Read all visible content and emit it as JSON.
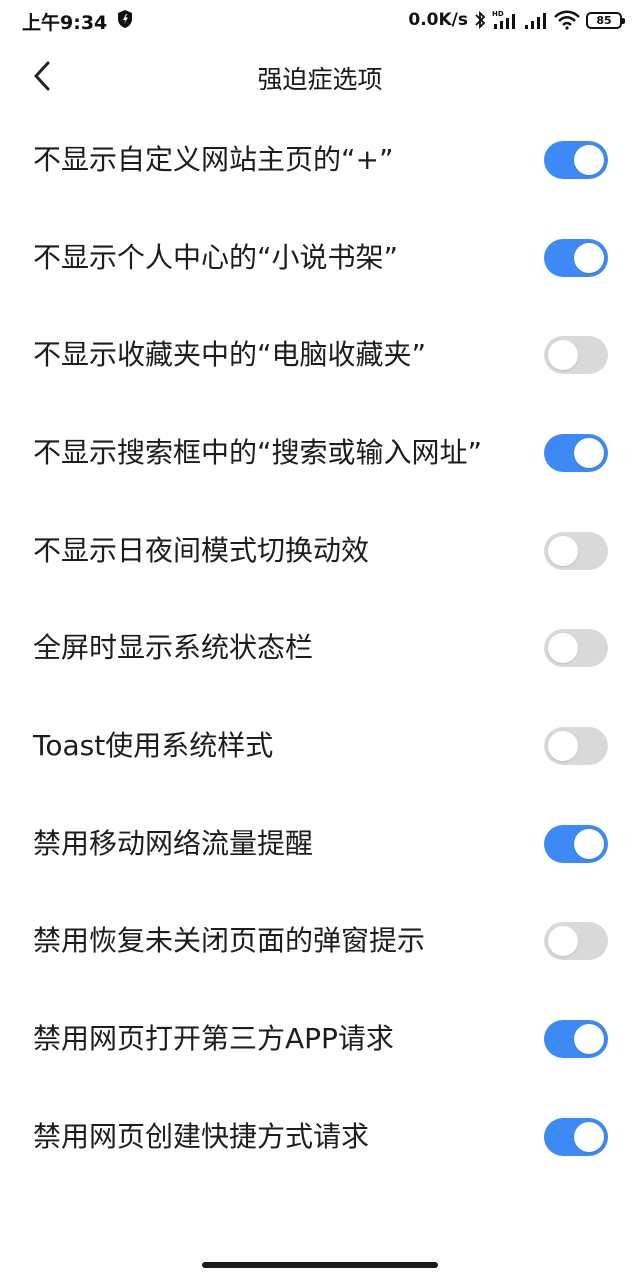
{
  "status_bar": {
    "time": "上午9:34",
    "net_speed": "0.0K/s",
    "battery": "85",
    "icons": [
      "shield-icon",
      "bluetooth-icon",
      "hd-signal-icon",
      "signal-icon",
      "wifi-icon",
      "battery-icon"
    ]
  },
  "header": {
    "title": "强迫症选项",
    "back_icon": "chevron-left-icon"
  },
  "settings": [
    {
      "label": "不显示自定义网站主页的“+”",
      "enabled": true
    },
    {
      "label": "不显示个人中心的“小说书架”",
      "enabled": true
    },
    {
      "label": "不显示收藏夹中的“电脑收藏夹”",
      "enabled": false
    },
    {
      "label": "不显示搜索框中的“搜索或输入网址”",
      "enabled": true
    },
    {
      "label": "不显示日夜间模式切换动效",
      "enabled": false
    },
    {
      "label": "全屏时显示系统状态栏",
      "enabled": false
    },
    {
      "label": "Toast使用系统样式",
      "enabled": false
    },
    {
      "label": "禁用移动网络流量提醒",
      "enabled": true
    },
    {
      "label": "禁用恢复未关闭页面的弹窗提示",
      "enabled": false
    },
    {
      "label": "禁用网页打开第三方APP请求",
      "enabled": true
    },
    {
      "label": "禁用网页创建快捷方式请求",
      "enabled": true
    }
  ],
  "colors": {
    "toggle_on": "#3d8af7",
    "toggle_off": "#d9d9d9",
    "text": "#1d1d1d",
    "background": "#ffffff"
  }
}
